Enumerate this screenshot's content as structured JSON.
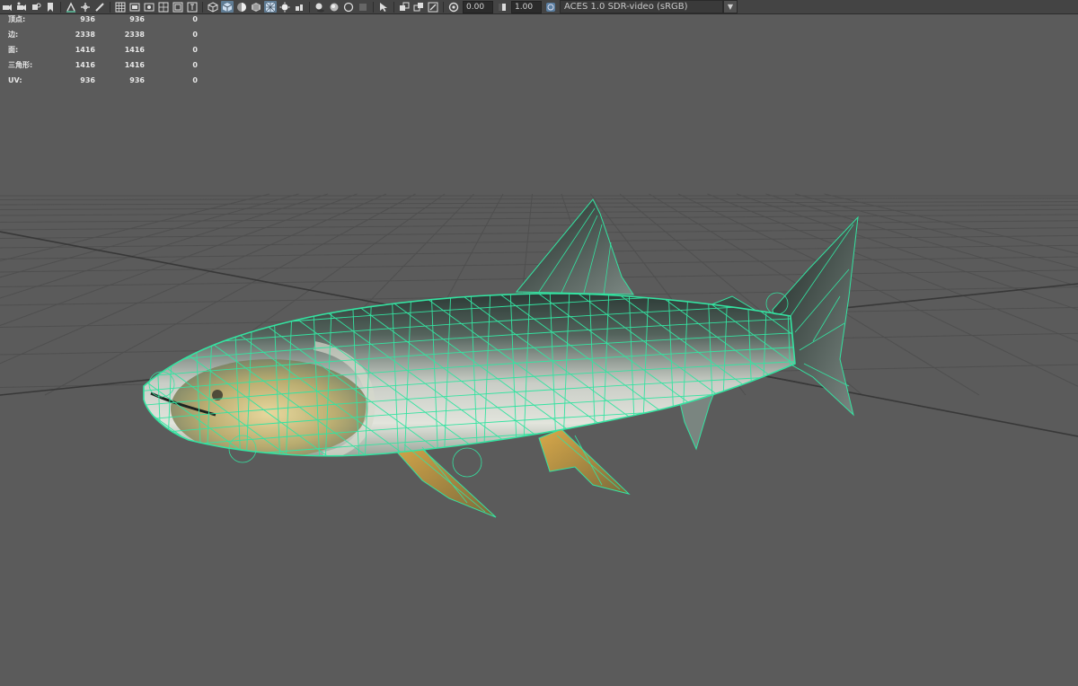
{
  "toolbar": {
    "icons": [
      "camera-select-icon",
      "camera-attributes-icon",
      "bookmark-icon",
      "image-plane-icon",
      "2d-pan-zoom-icon",
      "grease-pencil-icon",
      "grid-icon",
      "film-gate-icon",
      "resolution-gate-icon",
      "gate-mask-icon",
      "field-chart-icon",
      "safe-action-icon",
      "safe-title-icon",
      "wireframe-icon",
      "smooth-shade-icon",
      "default-material-icon",
      "textured-icon",
      "wireframe-on-shaded-icon",
      "xray-icon",
      "lights-icon",
      "shadows-icon",
      "ambient-occlusion-icon",
      "motion-blur-icon",
      "anti-aliasing-icon",
      "depth-of-field-icon",
      "isolate-select-icon",
      "xray-joints-icon",
      "xray-active-icon",
      "backface-culling-icon",
      "exposure-icon",
      "gamma-icon",
      "color-management-icon"
    ],
    "exposure_value": "0.00",
    "gamma_value": "1.00",
    "color_space": "ACES 1.0 SDR-video (sRGB)"
  },
  "hud": {
    "rows": [
      {
        "label": "顶点:",
        "c1": "936",
        "c2": "936",
        "c3": "0"
      },
      {
        "label": "边:",
        "c1": "2338",
        "c2": "2338",
        "c3": "0"
      },
      {
        "label": "面:",
        "c1": "1416",
        "c2": "1416",
        "c3": "0"
      },
      {
        "label": "三角形:",
        "c1": "1416",
        "c2": "1416",
        "c3": "0"
      },
      {
        "label": "UV:",
        "c1": "936",
        "c2": "936",
        "c3": "0"
      }
    ]
  },
  "viewport": {
    "background": "#5b5b5b",
    "grid_color": "#4d4d4d",
    "axis_color": "#3a3a3a",
    "wire_color": "#34e3a1",
    "model": "fish-mesh"
  }
}
